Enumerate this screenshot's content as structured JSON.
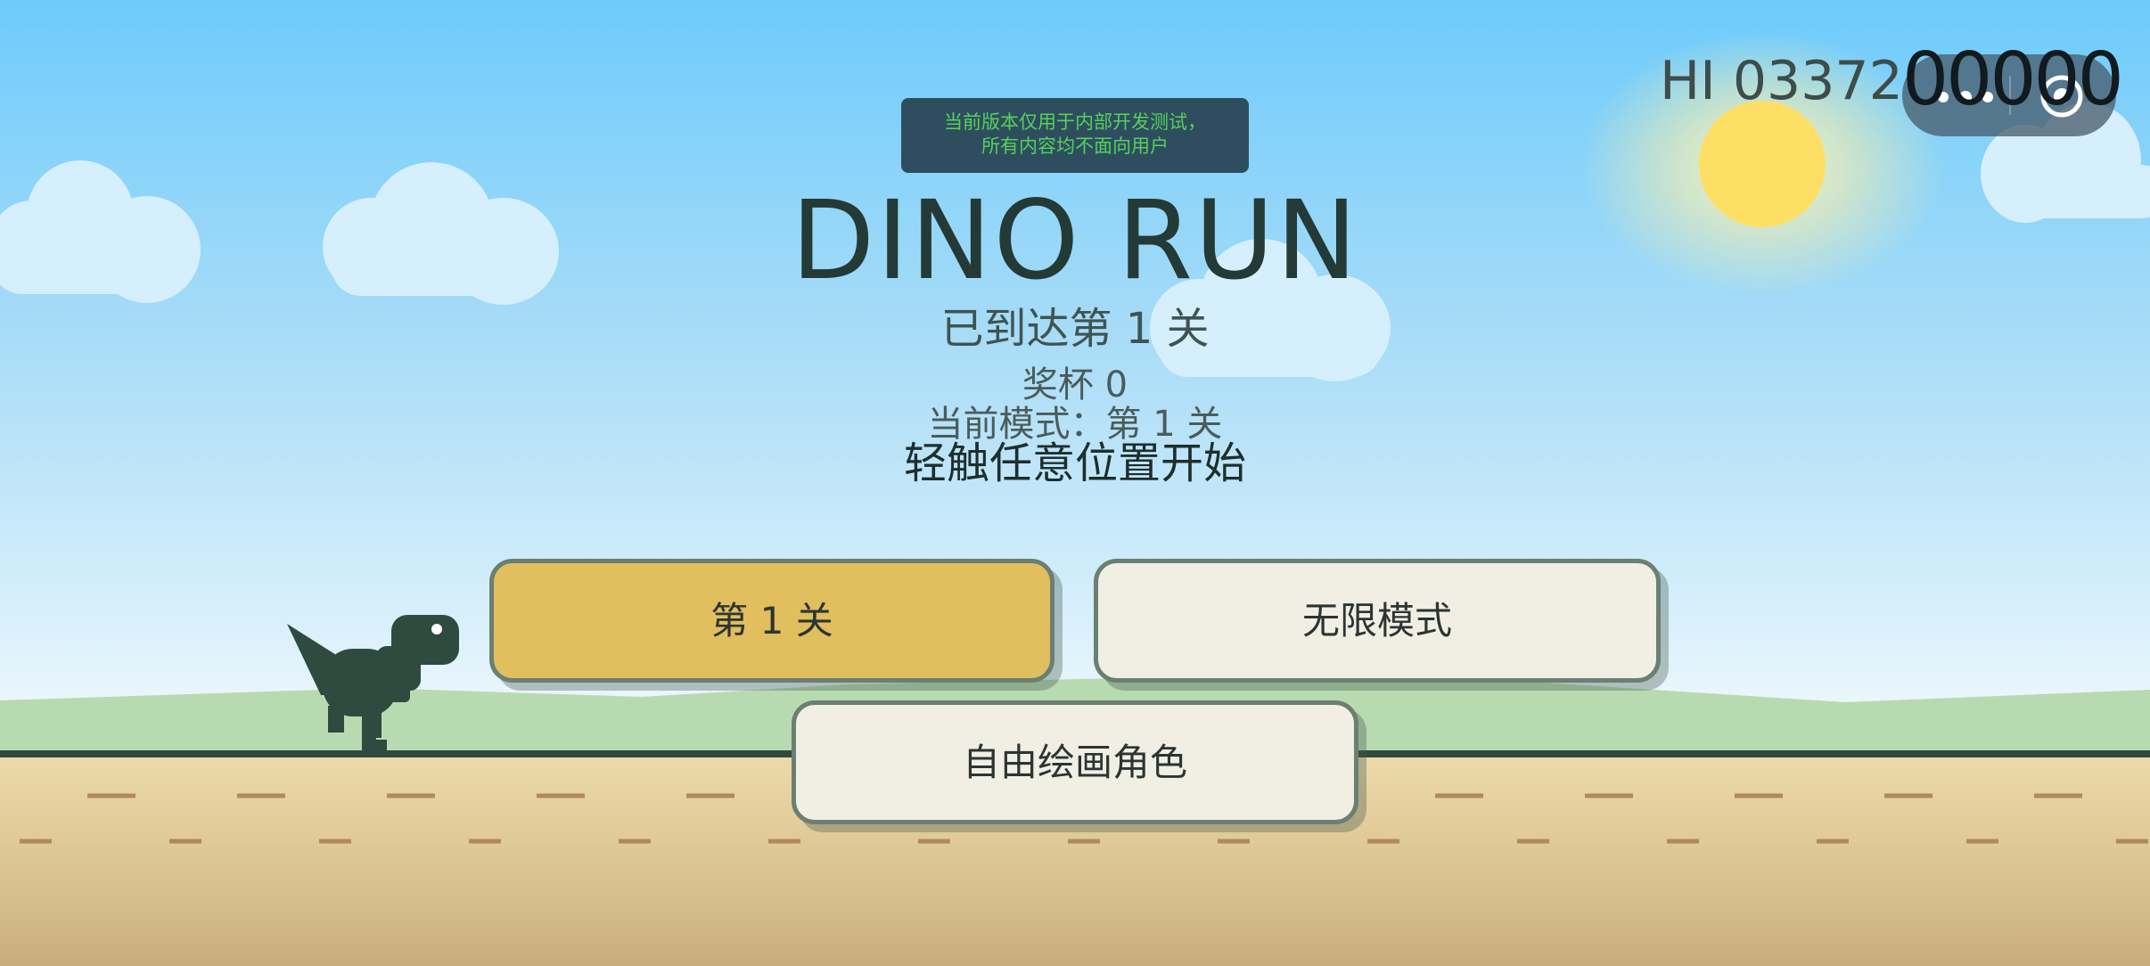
{
  "notice": {
    "line1": "当前版本仅用于内部开发测试，",
    "line2": "所有内容均不面向用户"
  },
  "title": "DINO RUN",
  "level_reached": "已到达第 1 关",
  "trophy": "奖杯 0",
  "mode": "当前模式：第 1 关",
  "hint": "轻触任意位置开始",
  "buttons": {
    "level": "第 1 关",
    "endless": "无限模式",
    "draw": "自由绘画角色"
  },
  "hud": {
    "hi_score": "HI 03372",
    "score": "00000"
  },
  "icons": {
    "more": "more-dots-icon",
    "close": "target-circle-icon",
    "sun": "sun-icon",
    "dino": "dinosaur-icon"
  },
  "colors": {
    "sky_top": "#6ecbfb",
    "sun": "#fedf66",
    "level_button": "#e1be5e",
    "secondary_button": "#f1efe4",
    "notice_text": "#55d05c",
    "dino": "#2f4a3f"
  }
}
